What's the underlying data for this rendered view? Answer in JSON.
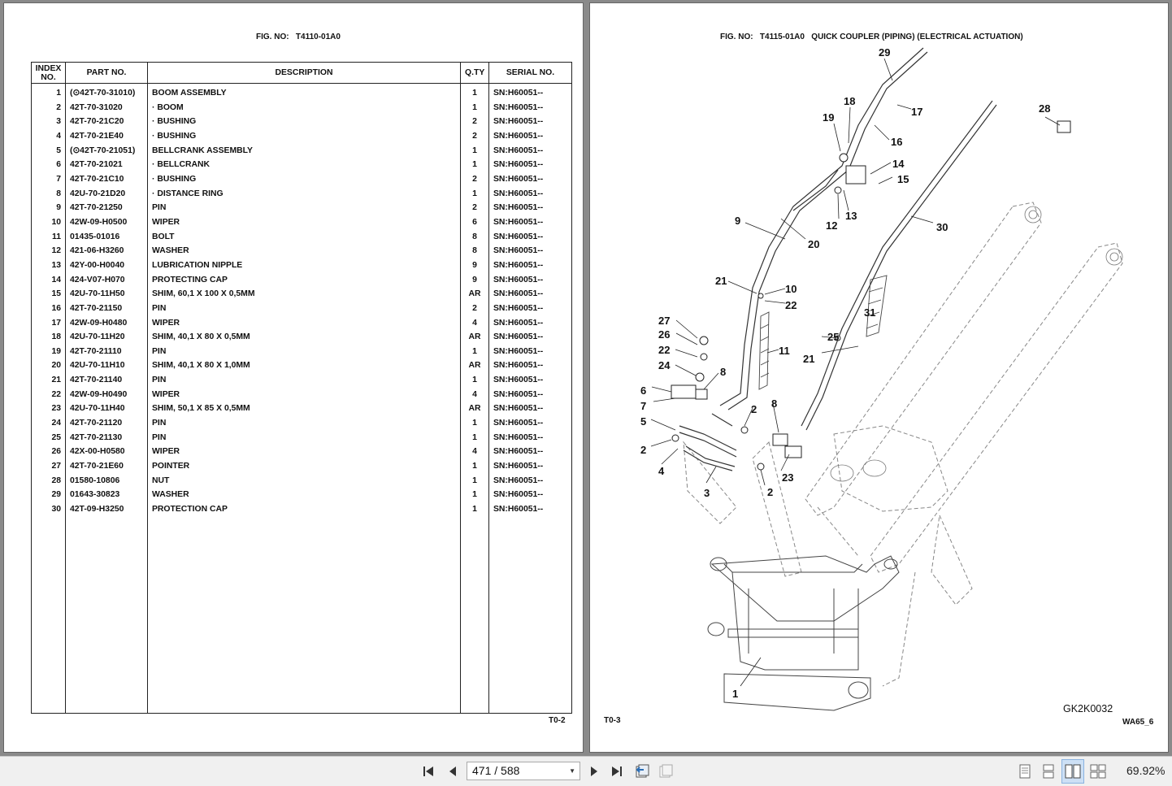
{
  "left_page": {
    "fig_label": "FIG. NO:",
    "fig_number": "T4110-01A0",
    "page_code": "T0-2",
    "columns": [
      "INDEX NO.",
      "PART NO.",
      "DESCRIPTION",
      "Q.TY",
      "SERIAL NO."
    ],
    "rows": [
      {
        "index": "1",
        "part": "(⊙42T-70-31010)",
        "desc": "BOOM ASSEMBLY",
        "qty": "1",
        "serial": "SN:H60051--"
      },
      {
        "index": "2",
        "part": "42T-70-31020",
        "desc": "· BOOM",
        "qty": "1",
        "serial": "SN:H60051--"
      },
      {
        "index": "3",
        "part": "42T-70-21C20",
        "desc": "· BUSHING",
        "qty": "2",
        "serial": "SN:H60051--"
      },
      {
        "index": "4",
        "part": "42T-70-21E40",
        "desc": "· BUSHING",
        "qty": "2",
        "serial": "SN:H60051--"
      },
      {
        "index": "5",
        "part": "(⊙42T-70-21051)",
        "desc": "BELLCRANK ASSEMBLY",
        "qty": "1",
        "serial": "SN:H60051--"
      },
      {
        "index": "6",
        "part": "42T-70-21021",
        "desc": "· BELLCRANK",
        "qty": "1",
        "serial": "SN:H60051--"
      },
      {
        "index": "7",
        "part": "42T-70-21C10",
        "desc": "· BUSHING",
        "qty": "2",
        "serial": "SN:H60051--"
      },
      {
        "index": "8",
        "part": "42U-70-21D20",
        "desc": "· DISTANCE RING",
        "qty": "1",
        "serial": "SN:H60051--"
      },
      {
        "index": "9",
        "part": "42T-70-21250",
        "desc": "PIN",
        "qty": "2",
        "serial": "SN:H60051--"
      },
      {
        "index": "10",
        "part": "42W-09-H0500",
        "desc": "WIPER",
        "qty": "6",
        "serial": "SN:H60051--"
      },
      {
        "index": "11",
        "part": "01435-01016",
        "desc": "BOLT",
        "qty": "8",
        "serial": "SN:H60051--"
      },
      {
        "index": "12",
        "part": "421-06-H3260",
        "desc": "WASHER",
        "qty": "8",
        "serial": "SN:H60051--"
      },
      {
        "index": "13",
        "part": "42Y-00-H0040",
        "desc": "LUBRICATION NIPPLE",
        "qty": "9",
        "serial": "SN:H60051--"
      },
      {
        "index": "14",
        "part": "424-V07-H070",
        "desc": "PROTECTING CAP",
        "qty": "9",
        "serial": "SN:H60051--"
      },
      {
        "index": "15",
        "part": "42U-70-11H50",
        "desc": "SHIM, 60,1 X 100 X 0,5MM",
        "qty": "AR",
        "serial": "SN:H60051--"
      },
      {
        "index": "16",
        "part": "42T-70-21150",
        "desc": "PIN",
        "qty": "2",
        "serial": "SN:H60051--"
      },
      {
        "index": "17",
        "part": "42W-09-H0480",
        "desc": "WIPER",
        "qty": "4",
        "serial": "SN:H60051--"
      },
      {
        "index": "18",
        "part": "42U-70-11H20",
        "desc": "SHIM, 40,1 X 80 X 0,5MM",
        "qty": "AR",
        "serial": "SN:H60051--"
      },
      {
        "index": "19",
        "part": "42T-70-21110",
        "desc": "PIN",
        "qty": "1",
        "serial": "SN:H60051--"
      },
      {
        "index": "20",
        "part": "42U-70-11H10",
        "desc": "SHIM, 40,1 X 80 X 1,0MM",
        "qty": "AR",
        "serial": "SN:H60051--"
      },
      {
        "index": "21",
        "part": "42T-70-21140",
        "desc": "PIN",
        "qty": "1",
        "serial": "SN:H60051--"
      },
      {
        "index": "22",
        "part": "42W-09-H0490",
        "desc": "WIPER",
        "qty": "4",
        "serial": "SN:H60051--"
      },
      {
        "index": "23",
        "part": "42U-70-11H40",
        "desc": "SHIM, 50,1 X 85 X 0,5MM",
        "qty": "AR",
        "serial": "SN:H60051--"
      },
      {
        "index": "24",
        "part": "42T-70-21120",
        "desc": "PIN",
        "qty": "1",
        "serial": "SN:H60051--"
      },
      {
        "index": "25",
        "part": "42T-70-21130",
        "desc": "PIN",
        "qty": "1",
        "serial": "SN:H60051--"
      },
      {
        "index": "26",
        "part": "42X-00-H0580",
        "desc": "WIPER",
        "qty": "4",
        "serial": "SN:H60051--"
      },
      {
        "index": "27",
        "part": "42T-70-21E60",
        "desc": "POINTER",
        "qty": "1",
        "serial": "SN:H60051--"
      },
      {
        "index": "28",
        "part": "01580-10806",
        "desc": "NUT",
        "qty": "1",
        "serial": "SN:H60051--"
      },
      {
        "index": "29",
        "part": "01643-30823",
        "desc": "WASHER",
        "qty": "1",
        "serial": "SN:H60051--"
      },
      {
        "index": "30",
        "part": "42T-09-H3250",
        "desc": "PROTECTION CAP",
        "qty": "1",
        "serial": "SN:H60051--"
      }
    ]
  },
  "right_page": {
    "fig_label": "FIG. NO:",
    "fig_number": "T4115-01A0",
    "fig_title": "QUICK COUPLER (PIPING) (ELECTRICAL ACTUATION)",
    "page_code": "T0-3",
    "drawing_code": "GK2K0032",
    "model_code": "WA65_6",
    "callouts": [
      "29",
      "18",
      "17",
      "19",
      "16",
      "14",
      "15",
      "28",
      "12",
      "13",
      "9",
      "20",
      "30",
      "21",
      "10",
      "22",
      "27",
      "31",
      "26",
      "25",
      "22",
      "21",
      "11",
      "24",
      "8",
      "6",
      "7",
      "2",
      "8",
      "5",
      "2",
      "4",
      "23",
      "3",
      "2",
      "1"
    ]
  },
  "toolbar": {
    "current_page": "471",
    "separator": "/",
    "total_pages": "588",
    "zoom": "69.92%"
  },
  "icons": [
    "first-page-icon",
    "prev-page-icon",
    "next-page-icon",
    "last-page-icon",
    "previous-view-icon",
    "next-view-icon",
    "single-page-icon",
    "continuous-icon",
    "facing-pages-icon",
    "continuous-facing-icon"
  ]
}
